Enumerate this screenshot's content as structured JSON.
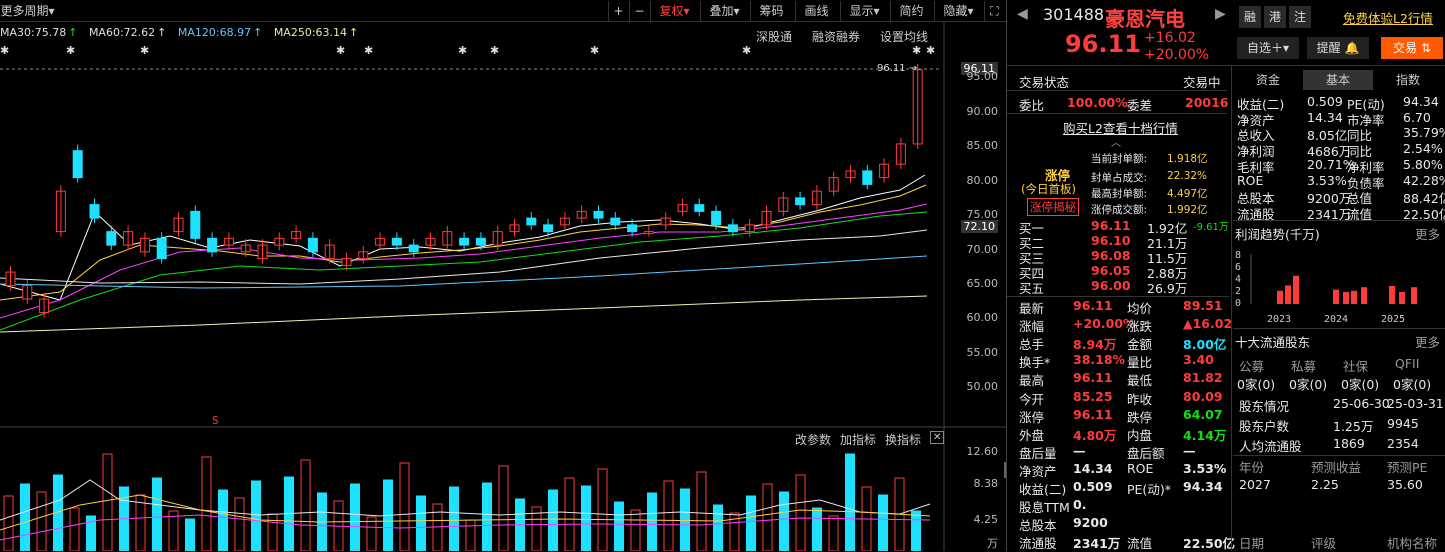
{
  "toolbar": {
    "period": "更多周期",
    "plus": "+",
    "minus": "−",
    "fuquan": "复权",
    "diejia": "叠加",
    "chouma": "筹码",
    "huaxian": "画线",
    "xianshi": "显示",
    "jianyue": "简约",
    "yincang": "隐藏"
  },
  "ma": {
    "ma30": "MA30:75.78",
    "ma60": "MA60:72.62",
    "ma120": "MA120:68.97",
    "ma250": "MA250:63.14"
  },
  "links": {
    "shengu": "深股通",
    "rongzi": "融资融券",
    "junxian": "设置均线"
  },
  "price_axis": [
    "96.11",
    "95.00",
    "90.00",
    "85.00",
    "80.00",
    "75.00",
    "72.10",
    "70.00",
    "65.00",
    "60.00",
    "55.00",
    "50.00"
  ],
  "price_line_label": "96.11",
  "ind_links": {
    "gai": "改参数",
    "jia": "加指标",
    "huan": "换指标"
  },
  "vol_axis": [
    "12.60",
    "8.38",
    "4.25"
  ],
  "vol_unit": "万",
  "stock": {
    "code": "301488",
    "name": "豪恩汽电",
    "price": "96.11",
    "chg": "+16.02",
    "pct": "+20.00%",
    "rong": "融",
    "gang": "港",
    "zhu": "注",
    "l2": "免费体验L2行情"
  },
  "buttons": {
    "zixuan": "自选＋",
    "tixing": "提醒",
    "jiaoyi": "交易"
  },
  "status": {
    "label": "交易状态",
    "value": "交易中"
  },
  "weibi": {
    "l1": "委比",
    "v1": "100.00%",
    "l2": "委差",
    "v2": "20016"
  },
  "l2link": "购买L2查看十档行情",
  "zt": {
    "title": "涨停",
    "sub": "(今日首板)",
    "btn": "涨停揭秘",
    "r1l": "当前封单额:",
    "r1v": "1.918亿",
    "r2l": "封单占成交:",
    "r2v": "22.32%",
    "r3l": "最高封单额:",
    "r3v": "4.497亿",
    "r4l": "涨停成交额:",
    "r4v": "1.992亿"
  },
  "bids": [
    {
      "n": "买一",
      "p": "96.11",
      "v": "1.92亿",
      "x": "-9.61万"
    },
    {
      "n": "买二",
      "p": "96.10",
      "v": "21.1万",
      "x": ""
    },
    {
      "n": "买三",
      "p": "96.08",
      "v": "11.5万",
      "x": ""
    },
    {
      "n": "买四",
      "p": "96.05",
      "v": "2.88万",
      "x": ""
    },
    {
      "n": "买五",
      "p": "96.00",
      "v": "26.9万",
      "x": ""
    }
  ],
  "quote": [
    [
      "最新",
      "96.11",
      "均价",
      "89.51"
    ],
    [
      "涨幅",
      "+20.00%",
      "涨跌",
      "▲16.02"
    ],
    [
      "总手",
      "8.94万",
      "金额",
      "8.00亿"
    ],
    [
      "换手*",
      "38.18%",
      "量比",
      "3.40"
    ],
    [
      "最高",
      "96.11",
      "最低",
      "81.82"
    ],
    [
      "今开",
      "85.25",
      "昨收",
      "80.09"
    ],
    [
      "涨停",
      "96.11",
      "跌停",
      "64.07"
    ],
    [
      "外盘",
      "4.80万",
      "内盘",
      "4.14万"
    ],
    [
      "盘后量",
      "—",
      "盘后额",
      "—"
    ],
    [
      "净资产",
      "14.34",
      "ROE",
      "3.53%"
    ],
    [
      "收益(二)",
      "0.509",
      "PE(动)*",
      "94.34"
    ],
    [
      "股息TTM",
      "0.",
      "",
      ""
    ],
    [
      "总股本",
      "9200",
      "",
      ""
    ],
    [
      "流通股",
      "2341万",
      "流值",
      "22.50亿"
    ]
  ],
  "tabs3": [
    "资金",
    "基本",
    "指数"
  ],
  "fund": [
    [
      "收益(二)",
      "0.509",
      "PE(动)",
      "94.34"
    ],
    [
      "净资产",
      "14.34",
      "市净率",
      "6.70"
    ],
    [
      "总收入",
      "8.05亿",
      "同比",
      "35.79%"
    ],
    [
      "净利润",
      "4686万",
      "同比",
      "2.54%"
    ],
    [
      "毛利率",
      "20.71%",
      "净利率",
      "5.80%"
    ],
    [
      "ROE",
      "3.53%",
      "负债率",
      "42.28%"
    ],
    [
      "总股本",
      "9200万",
      "总值",
      "88.42亿"
    ],
    [
      "流通股",
      "2341万",
      "流值",
      "22.50亿"
    ]
  ],
  "profit": {
    "title": "利润趋势(千万)",
    "more": "更多",
    "y": [
      "8",
      "6",
      "4",
      "2",
      "0"
    ],
    "x": [
      "2023",
      "2024",
      "2025"
    ],
    "bars": [
      2.2,
      3.1,
      4.7,
      2.4,
      2.0,
      2.2,
      2.8,
      3.0,
      2.0,
      2.8
    ]
  },
  "holders": {
    "title": "十大流通股东",
    "more": "更多",
    "cols": [
      "公募",
      "私募",
      "社保",
      "QFII"
    ],
    "vals": [
      "0家(0)",
      "0家(0)",
      "0家(0)",
      "0家(0)"
    ]
  },
  "holders2": [
    [
      "股东情况",
      "25-06-30",
      "25-03-31"
    ],
    [
      "股东户数",
      "1.25万",
      "9945"
    ],
    [
      "人均流通股",
      "1869",
      "2354"
    ]
  ],
  "forecast": {
    "h": [
      "年份",
      "预测收益",
      "预测PE"
    ],
    "r": [
      "2027",
      "2.25",
      "35.60"
    ],
    "f": [
      "日期",
      "评级",
      "机构名称"
    ]
  }
}
